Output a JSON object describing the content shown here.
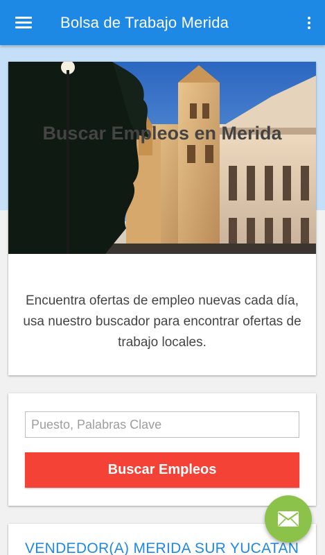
{
  "app_bar": {
    "title": "Bolsa de Trabajo Merida",
    "menu_icon": "hamburger-menu-icon",
    "overflow_icon": "more-vertical-icon",
    "color": "#1e88e5"
  },
  "hero": {
    "title": "Buscar Empleos en Merida",
    "description": "Encuentra ofertas de empleo nuevas cada día, usa nuestro buscador para encontrar ofertas de trabajo locales."
  },
  "search": {
    "placeholder": "Puesto, Palabras Clave",
    "value": "",
    "button_label": "Buscar Empleos",
    "button_color": "#f44336"
  },
  "jobs": [
    {
      "title": "VENDEDOR(A) MERIDA SUR YUCATAN"
    }
  ],
  "fab": {
    "icon": "mail-icon",
    "color": "#8bc34a"
  }
}
